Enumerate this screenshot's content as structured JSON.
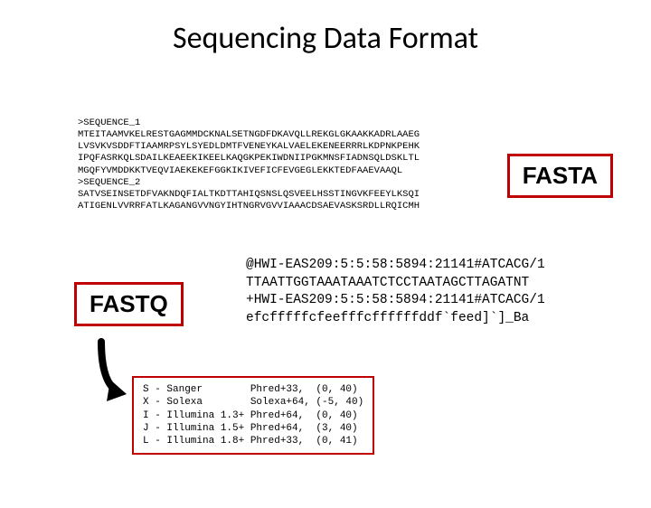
{
  "title": "Sequencing Data Format",
  "fasta_block": ">SEQUENCE_1\nMTEITAAMVKELRESTGAGMMDCKNALSETNGDFDKAVQLLREKGLGKAAKKADRLAAEG\nLVSVKVSDDFTIAAMRPSYLSYEDLDMTFVENEYKALVAELEKENEERRRLKDPNKPEHK\nIPQFASRKQLSDAILKEAEEKIKEELKAQGKPEKIWDNIIPGKMNSFIADNSQLDSKLTL\nMGQFYVMDDKKTVEQVIAEKEKEFGGKIKIVEFICFEVGEGLEKKTEDFAAEVAAQL\n>SEQUENCE_2\nSATVSEINSETDFVAKNDQFIALTKDTTAHIQSNSLQSVEELHSSTINGVKFEEYLKSQI\nATIGENLVVRRFATLKAGANGVVNGYIHTNGRVGVVIAAACDSAEVASKSRDLLRQICMH",
  "fasta_label": "FASTA",
  "fastq_label": "FASTQ",
  "fastq_block": "@HWI-EAS209:5:5:58:5894:21141#ATCACG/1\nTTAATTGGTAAATAAATCTCCTAATAGCTTAGATNT\n+HWI-EAS209:5:5:58:5894:21141#ATCACG/1\nefcfffffcfeefffcffffffddf`feed]`]_Ba",
  "encoding_table": "S - Sanger        Phred+33,  (0, 40)\nX - Solexa        Solexa+64, (-5, 40)\nI - Illumina 1.3+ Phred+64,  (0, 40)\nJ - Illumina 1.5+ Phred+64,  (3, 40)\nL - Illumina 1.8+ Phred+33,  (0, 41)"
}
